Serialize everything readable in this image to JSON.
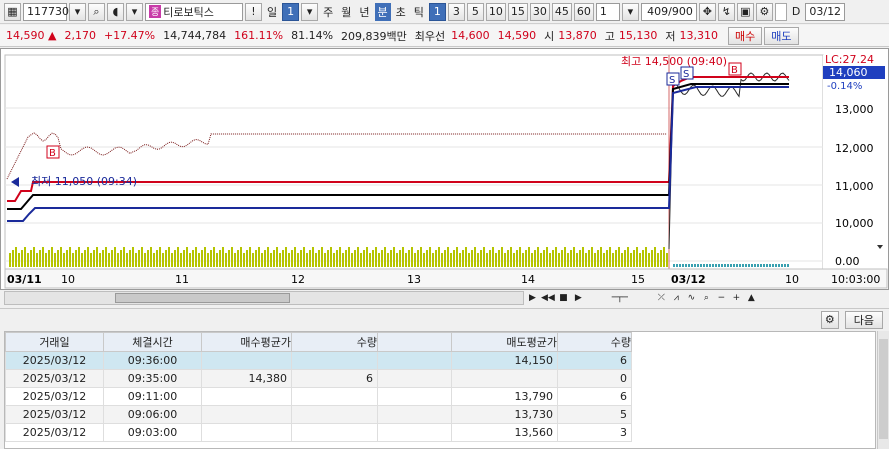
{
  "toolbar": {
    "code": "117730",
    "stock_name": "티로보틱스",
    "exclaim": "!",
    "period_sel": "일",
    "period_num": "1",
    "periods": [
      "주",
      "월",
      "년",
      "분",
      "초",
      "틱"
    ],
    "interval_buttons": [
      "1",
      "3",
      "5",
      "10",
      "15",
      "30",
      "45",
      "60"
    ],
    "interval_select": "1",
    "count_display": "409/900",
    "d_label": "D",
    "date": "03/12"
  },
  "quote": {
    "price": "14,590",
    "change_arrow": "▲",
    "change": "2,170",
    "change_pct": "+17.47%",
    "volume": "14,744,784",
    "vol_ratio": "161.11%",
    "strength": "81.14%",
    "amount": "209,839백만",
    "best_quote_label": "최우선",
    "ask": "14,600",
    "bid": "14,590",
    "open_label": "시",
    "open": "13,870",
    "high_label": "고",
    "high": "15,130",
    "low_label": "저",
    "low": "13,310",
    "buy_label": "매수",
    "sell_label": "매도"
  },
  "chart": {
    "high_annotation": "최고 14,500 (09:40)",
    "low_annotation": "최저 11,050 (09:34)",
    "lc_label": "LC:27.24",
    "current_price": "14,060",
    "current_pct": "-0.14%",
    "price_ticks": [
      "13,000",
      "12,000",
      "11,000",
      "10,000"
    ],
    "volume_tick": "0.00",
    "time_labels": [
      "03/11",
      "10",
      "11",
      "12",
      "13",
      "14",
      "15",
      "03/12",
      "10",
      "10:03:00"
    ],
    "marker_b": "B",
    "marker_s": "S",
    "colors": {
      "price": "#7a1a1a",
      "red_line": "#d0021b",
      "black_line": "#000000",
      "blue_line": "#1a2a9a",
      "volume": "#b5c400",
      "accent": "#3f6fb8"
    }
  },
  "chart_data": {
    "type": "line",
    "x": [
      "03/11",
      "10",
      "11",
      "12",
      "13",
      "14",
      "15",
      "03/12",
      "10"
    ],
    "series": [],
    "ylim": [
      9500,
      14500
    ],
    "ylabel": "",
    "xlabel": "",
    "annotations": [
      "최고 14,500 (09:40)",
      "최저 11,050 (09:34)",
      "LC:27.24"
    ]
  },
  "lower": {
    "next_label": "다음",
    "columns": [
      "거래일",
      "체결시간",
      "매수평균가",
      "수량",
      "",
      "매도평균가",
      "수량"
    ],
    "rows": [
      [
        "2025/03/12",
        "09:36:00",
        "",
        "",
        "",
        "14,150",
        "6"
      ],
      [
        "2025/03/12",
        "09:35:00",
        "14,380",
        "6",
        "",
        "",
        "0"
      ],
      [
        "2025/03/12",
        "09:11:00",
        "",
        "",
        "",
        "13,790",
        "6"
      ],
      [
        "2025/03/12",
        "09:06:00",
        "",
        "",
        "",
        "13,730",
        "5"
      ],
      [
        "2025/03/12",
        "09:03:00",
        "",
        "",
        "",
        "13,560",
        "3"
      ]
    ]
  }
}
